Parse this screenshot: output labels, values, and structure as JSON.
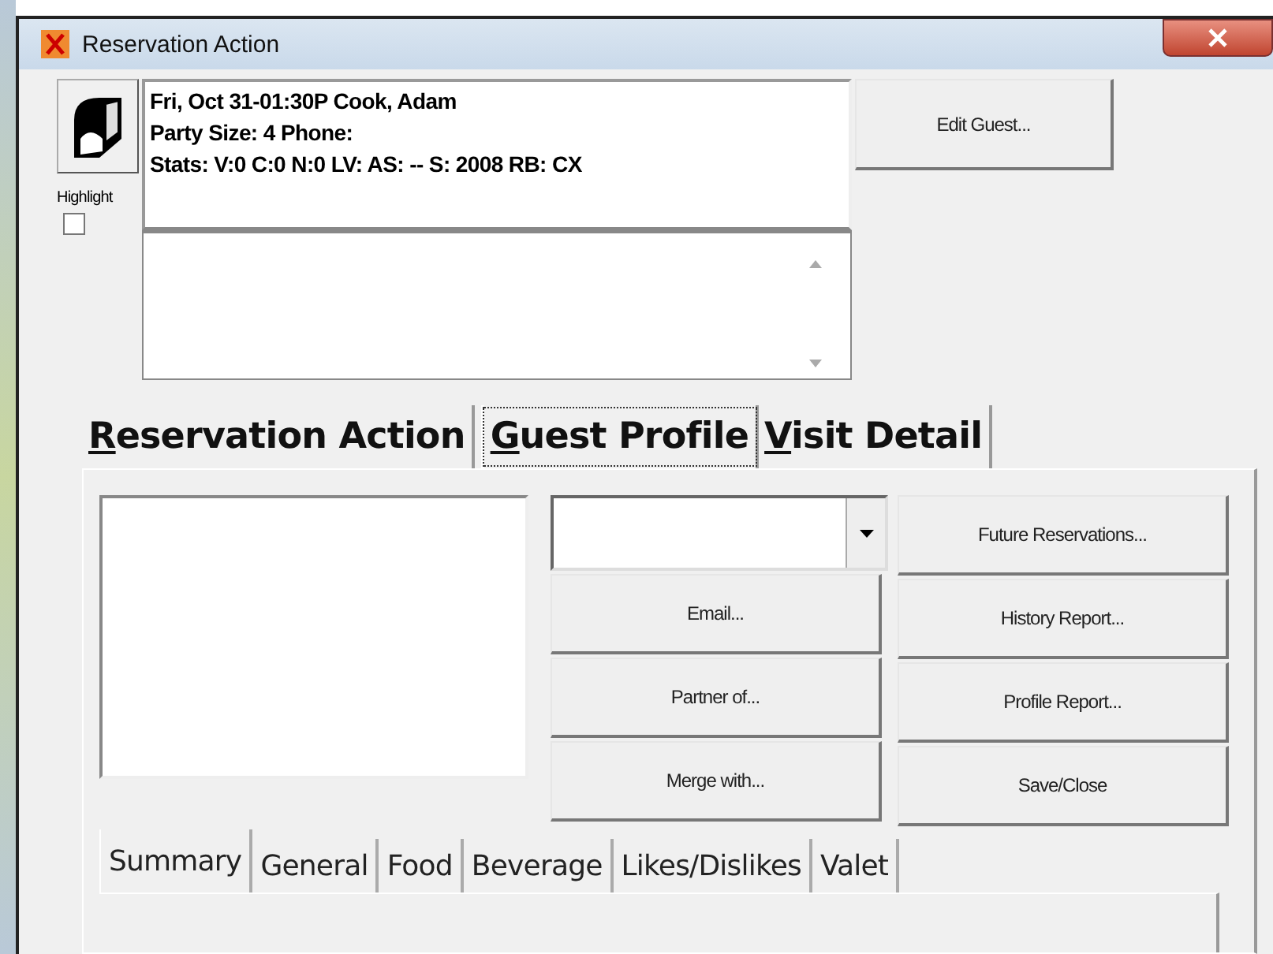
{
  "window": {
    "title": "Reservation Action"
  },
  "info": {
    "lines": [
      "Fri, Oct 31-01:30P   Cook, Adam",
      "Party Size: 4    Phone:",
      "Stats: V:0 C:0 N:0 LV: AS: -- S: 2008 RB: CX"
    ]
  },
  "edit_guest_button": "Edit Guest...",
  "highlight": {
    "label": "Highlight",
    "checked": false
  },
  "tabs": [
    {
      "label": "Reservation Action",
      "selected": false
    },
    {
      "label": "Guest Profile",
      "selected": true
    },
    {
      "label": "Visit Detail",
      "selected": false
    }
  ],
  "action_buttons": [
    "Email...",
    "Partner of...",
    "Merge with..."
  ],
  "report_buttons": [
    "Future Reservations...",
    "History Report...",
    "Profile Report...",
    "Save/Close"
  ],
  "subtabs": [
    {
      "label": "Summary",
      "selected": true
    },
    {
      "label": "General",
      "selected": false
    },
    {
      "label": "Food",
      "selected": false
    },
    {
      "label": "Beverage",
      "selected": false
    },
    {
      "label": "Likes/Dislikes",
      "selected": false
    },
    {
      "label": "Valet",
      "selected": false
    }
  ]
}
